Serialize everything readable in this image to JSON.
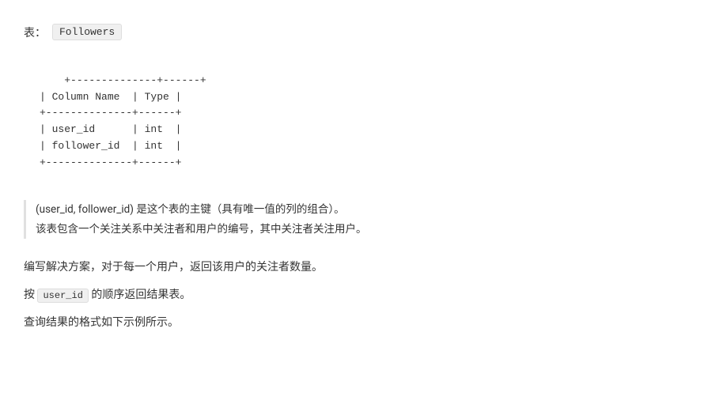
{
  "header": {
    "label": "表：",
    "table_name": "Followers"
  },
  "schema": {
    "border_top": "+--------------+------+",
    "header_row": "| Column Name  | Type |",
    "border_mid": "+--------------+------+",
    "row1": "| user_id      | int  |",
    "row2": "| follower_id  | int  |",
    "border_bot": "+--------------+------+"
  },
  "description": {
    "line1": "(user_id, follower_id) 是这个表的主键（具有唯一值的列的组合）。",
    "line2": "该表包含一个关注关系中关注者和用户的编号，其中关注者关注用户。"
  },
  "task": {
    "instruction": "编写解决方案，对于每一个用户，返回该用户的关注者数量。",
    "order_text_prefix": "按 ",
    "order_field": "user_id",
    "order_text_suffix": " 的顺序返回结果表。",
    "format_note": "查询结果的格式如下示例所示。"
  }
}
